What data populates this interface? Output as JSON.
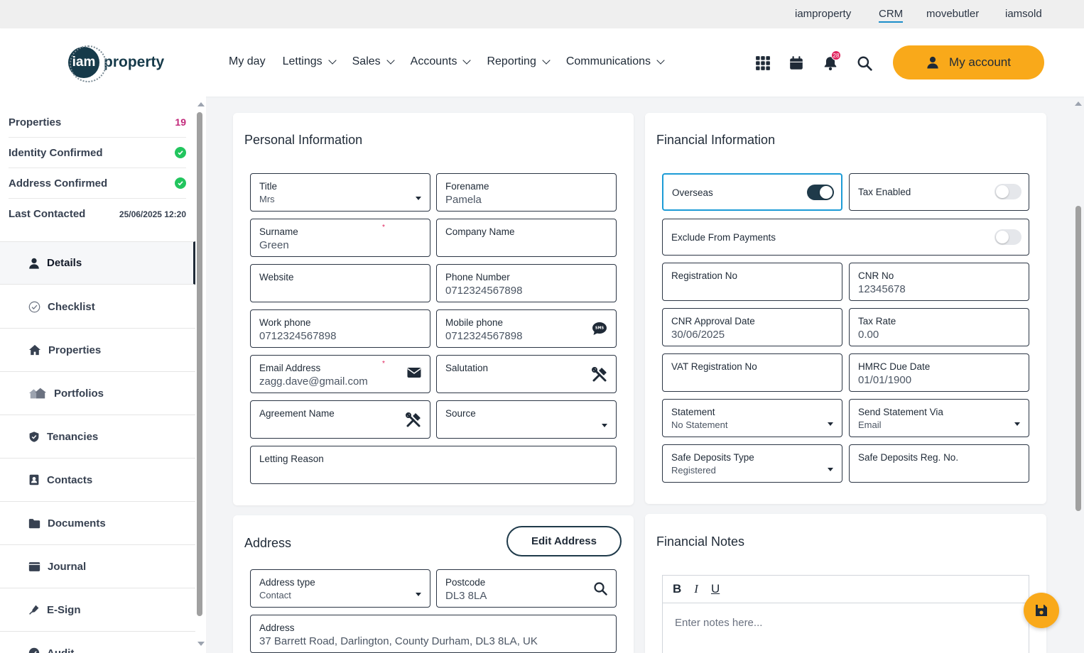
{
  "brands": [
    {
      "label": "iamproperty",
      "active": false
    },
    {
      "label": "CRM",
      "active": true
    },
    {
      "label": "movebutler",
      "active": false
    },
    {
      "label": "iamsold",
      "active": false
    }
  ],
  "logo": {
    "mark": "iam",
    "word": "property"
  },
  "nav": [
    "My day",
    "Lettings",
    "Sales",
    "Accounts",
    "Reporting",
    "Communications"
  ],
  "header": {
    "notification_count": "28",
    "account_label": "My account"
  },
  "colors": {
    "accent": "#f9a91a",
    "brand_dark": "#163a4a",
    "highlight": "#1c9bd6",
    "success": "#22c55e",
    "count": "#c2287a"
  },
  "summary": {
    "properties_label": "Properties",
    "properties_count": "19",
    "identity_label": "Identity Confirmed",
    "address_label": "Address Confirmed",
    "last_contacted_label": "Last Contacted",
    "last_contacted_value": "25/06/2025 12:20"
  },
  "menu": {
    "details": "Details",
    "checklist": "Checklist",
    "properties": "Properties",
    "portfolios": "Portfolios",
    "tenancies": "Tenancies",
    "contacts": "Contacts",
    "documents": "Documents",
    "journal": "Journal",
    "esign": "E-Sign",
    "audit": "Audit"
  },
  "personal": {
    "title": "Personal Information",
    "title_field": {
      "label": "Title",
      "value": "Mrs"
    },
    "forename": {
      "label": "Forename",
      "value": "Pamela"
    },
    "surname": {
      "label": "Surname",
      "value": "Green"
    },
    "company": {
      "label": "Company Name",
      "value": ""
    },
    "website": {
      "label": "Website",
      "value": ""
    },
    "phone": {
      "label": "Phone Number",
      "value": "0712324567898"
    },
    "work_phone": {
      "label": "Work phone",
      "value": "0712324567898"
    },
    "mobile": {
      "label": "Mobile phone",
      "value": "0712324567898"
    },
    "email": {
      "label": "Email Address",
      "value": "zagg.dave@gmail.com"
    },
    "salutation": {
      "label": "Salutation",
      "value": ""
    },
    "agreement": {
      "label": "Agreement Name",
      "value": ""
    },
    "source": {
      "label": "Source",
      "value": ""
    },
    "letting_reason": {
      "label": "Letting Reason",
      "value": ""
    },
    "required_mark": "*"
  },
  "financial": {
    "title": "Financial Information",
    "overseas": {
      "label": "Overseas",
      "on": true
    },
    "tax_enabled": {
      "label": "Tax Enabled",
      "on": false
    },
    "exclude_payments": {
      "label": "Exclude From Payments",
      "on": false
    },
    "registration_no": {
      "label": "Registration No",
      "value": ""
    },
    "cnr_no": {
      "label": "CNR No",
      "value": "12345678"
    },
    "cnr_approval": {
      "label": "CNR Approval Date",
      "value": "30/06/2025"
    },
    "tax_rate": {
      "label": "Tax Rate",
      "value": "0.00"
    },
    "vat_no": {
      "label": "VAT Registration No",
      "value": ""
    },
    "hmrc_due": {
      "label": "HMRC Due Date",
      "value": "01/01/1900"
    },
    "statement": {
      "label": "Statement",
      "value": "No Statement"
    },
    "send_via": {
      "label": "Send Statement Via",
      "value": "Email"
    },
    "deposit_type": {
      "label": "Safe Deposits Type",
      "value": "Registered"
    },
    "deposit_reg": {
      "label": "Safe Deposits Reg. No.",
      "value": ""
    }
  },
  "address": {
    "title": "Address",
    "edit_label": "Edit Address",
    "type": {
      "label": "Address type",
      "value": "Contact"
    },
    "postcode": {
      "label": "Postcode",
      "value": "DL3 8LA"
    },
    "full": {
      "label": "Address",
      "value": "37 Barrett Road, Darlington, County Durham, DL3 8LA, UK"
    }
  },
  "notes": {
    "title": "Financial Notes",
    "bold": "B",
    "italic": "I",
    "underline": "U",
    "placeholder": "Enter notes here..."
  }
}
